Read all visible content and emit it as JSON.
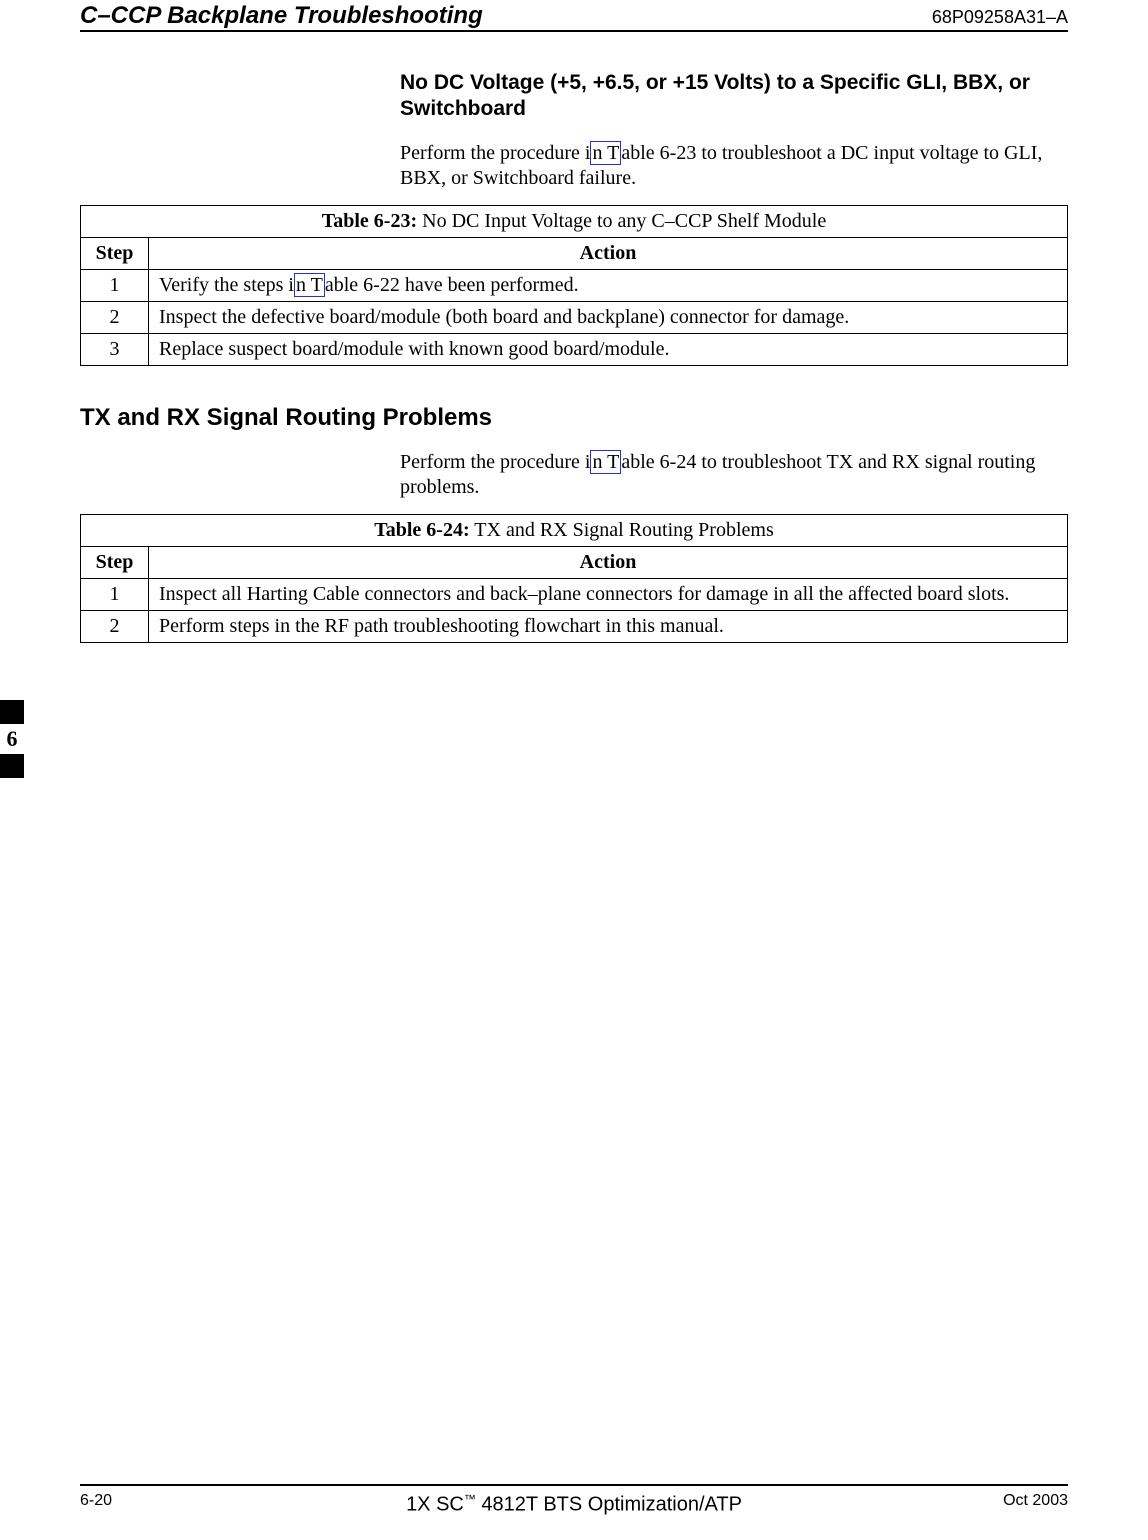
{
  "header": {
    "title": "C–CCP Backplane Troubleshooting",
    "docnum": "68P09258A31–A"
  },
  "section1": {
    "heading": "No DC Voltage (+5, +6.5, or +15 Volts) to a Specific GLI, BBX, or Switchboard",
    "para_pre": "Perform the procedure i",
    "para_link": "n T",
    "para_post": "able 6-23 to troubleshoot a DC input voltage to GLI, BBX, or Switchboard failure."
  },
  "table1": {
    "caption_bold": "Table 6-23:",
    "caption_rest": " No DC Input Voltage to any C–CCP Shelf Module",
    "col_step": "Step",
    "col_action": "Action",
    "rows": [
      {
        "step": "1",
        "pre": "Verify the steps i",
        "link": "n T",
        "post": "able 6-22 have been performed."
      },
      {
        "step": "2",
        "action": "Inspect the defective board/module (both board and backplane) connector for damage."
      },
      {
        "step": "3",
        "action": "Replace suspect board/module with known good board/module."
      }
    ]
  },
  "section2": {
    "heading": "TX and RX Signal Routing Problems",
    "para_pre": "Perform the procedure i",
    "para_link": "n T",
    "para_post": "able 6-24 to troubleshoot TX and RX signal routing problems."
  },
  "table2": {
    "caption_bold": "Table 6-24:",
    "caption_rest": " TX and RX Signal Routing Problems",
    "col_step": "Step",
    "col_action": "Action",
    "rows": [
      {
        "step": "1",
        "action": "Inspect all Harting Cable connectors and back–plane connectors for damage in all the affected board slots."
      },
      {
        "step": "2",
        "action": "Perform steps in the RF path troubleshooting flowchart in this manual."
      }
    ]
  },
  "sidetab": "6",
  "footer": {
    "left": "6-20",
    "center_pre": "1X SC",
    "center_tm": "™",
    "center_post": " 4812T BTS Optimization/ATP",
    "right": "Oct 2003"
  }
}
